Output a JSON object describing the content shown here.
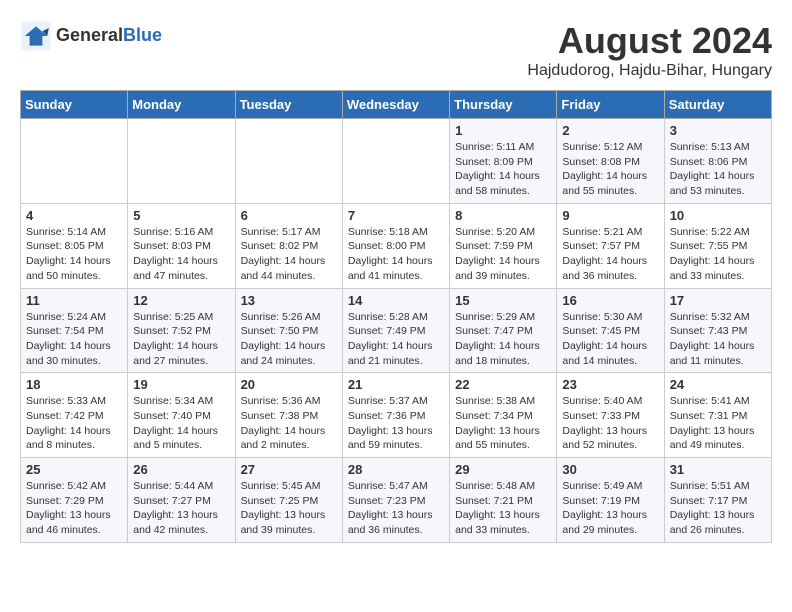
{
  "header": {
    "logo_line1": "General",
    "logo_line2": "Blue",
    "month_year": "August 2024",
    "location": "Hajdudorog, Hajdu-Bihar, Hungary"
  },
  "weekdays": [
    "Sunday",
    "Monday",
    "Tuesday",
    "Wednesday",
    "Thursday",
    "Friday",
    "Saturday"
  ],
  "weeks": [
    [
      {
        "day": "",
        "info": ""
      },
      {
        "day": "",
        "info": ""
      },
      {
        "day": "",
        "info": ""
      },
      {
        "day": "",
        "info": ""
      },
      {
        "day": "1",
        "info": "Sunrise: 5:11 AM\nSunset: 8:09 PM\nDaylight: 14 hours\nand 58 minutes."
      },
      {
        "day": "2",
        "info": "Sunrise: 5:12 AM\nSunset: 8:08 PM\nDaylight: 14 hours\nand 55 minutes."
      },
      {
        "day": "3",
        "info": "Sunrise: 5:13 AM\nSunset: 8:06 PM\nDaylight: 14 hours\nand 53 minutes."
      }
    ],
    [
      {
        "day": "4",
        "info": "Sunrise: 5:14 AM\nSunset: 8:05 PM\nDaylight: 14 hours\nand 50 minutes."
      },
      {
        "day": "5",
        "info": "Sunrise: 5:16 AM\nSunset: 8:03 PM\nDaylight: 14 hours\nand 47 minutes."
      },
      {
        "day": "6",
        "info": "Sunrise: 5:17 AM\nSunset: 8:02 PM\nDaylight: 14 hours\nand 44 minutes."
      },
      {
        "day": "7",
        "info": "Sunrise: 5:18 AM\nSunset: 8:00 PM\nDaylight: 14 hours\nand 41 minutes."
      },
      {
        "day": "8",
        "info": "Sunrise: 5:20 AM\nSunset: 7:59 PM\nDaylight: 14 hours\nand 39 minutes."
      },
      {
        "day": "9",
        "info": "Sunrise: 5:21 AM\nSunset: 7:57 PM\nDaylight: 14 hours\nand 36 minutes."
      },
      {
        "day": "10",
        "info": "Sunrise: 5:22 AM\nSunset: 7:55 PM\nDaylight: 14 hours\nand 33 minutes."
      }
    ],
    [
      {
        "day": "11",
        "info": "Sunrise: 5:24 AM\nSunset: 7:54 PM\nDaylight: 14 hours\nand 30 minutes."
      },
      {
        "day": "12",
        "info": "Sunrise: 5:25 AM\nSunset: 7:52 PM\nDaylight: 14 hours\nand 27 minutes."
      },
      {
        "day": "13",
        "info": "Sunrise: 5:26 AM\nSunset: 7:50 PM\nDaylight: 14 hours\nand 24 minutes."
      },
      {
        "day": "14",
        "info": "Sunrise: 5:28 AM\nSunset: 7:49 PM\nDaylight: 14 hours\nand 21 minutes."
      },
      {
        "day": "15",
        "info": "Sunrise: 5:29 AM\nSunset: 7:47 PM\nDaylight: 14 hours\nand 18 minutes."
      },
      {
        "day": "16",
        "info": "Sunrise: 5:30 AM\nSunset: 7:45 PM\nDaylight: 14 hours\nand 14 minutes."
      },
      {
        "day": "17",
        "info": "Sunrise: 5:32 AM\nSunset: 7:43 PM\nDaylight: 14 hours\nand 11 minutes."
      }
    ],
    [
      {
        "day": "18",
        "info": "Sunrise: 5:33 AM\nSunset: 7:42 PM\nDaylight: 14 hours\nand 8 minutes."
      },
      {
        "day": "19",
        "info": "Sunrise: 5:34 AM\nSunset: 7:40 PM\nDaylight: 14 hours\nand 5 minutes."
      },
      {
        "day": "20",
        "info": "Sunrise: 5:36 AM\nSunset: 7:38 PM\nDaylight: 14 hours\nand 2 minutes."
      },
      {
        "day": "21",
        "info": "Sunrise: 5:37 AM\nSunset: 7:36 PM\nDaylight: 13 hours\nand 59 minutes."
      },
      {
        "day": "22",
        "info": "Sunrise: 5:38 AM\nSunset: 7:34 PM\nDaylight: 13 hours\nand 55 minutes."
      },
      {
        "day": "23",
        "info": "Sunrise: 5:40 AM\nSunset: 7:33 PM\nDaylight: 13 hours\nand 52 minutes."
      },
      {
        "day": "24",
        "info": "Sunrise: 5:41 AM\nSunset: 7:31 PM\nDaylight: 13 hours\nand 49 minutes."
      }
    ],
    [
      {
        "day": "25",
        "info": "Sunrise: 5:42 AM\nSunset: 7:29 PM\nDaylight: 13 hours\nand 46 minutes."
      },
      {
        "day": "26",
        "info": "Sunrise: 5:44 AM\nSunset: 7:27 PM\nDaylight: 13 hours\nand 42 minutes."
      },
      {
        "day": "27",
        "info": "Sunrise: 5:45 AM\nSunset: 7:25 PM\nDaylight: 13 hours\nand 39 minutes."
      },
      {
        "day": "28",
        "info": "Sunrise: 5:47 AM\nSunset: 7:23 PM\nDaylight: 13 hours\nand 36 minutes."
      },
      {
        "day": "29",
        "info": "Sunrise: 5:48 AM\nSunset: 7:21 PM\nDaylight: 13 hours\nand 33 minutes."
      },
      {
        "day": "30",
        "info": "Sunrise: 5:49 AM\nSunset: 7:19 PM\nDaylight: 13 hours\nand 29 minutes."
      },
      {
        "day": "31",
        "info": "Sunrise: 5:51 AM\nSunset: 7:17 PM\nDaylight: 13 hours\nand 26 minutes."
      }
    ]
  ]
}
